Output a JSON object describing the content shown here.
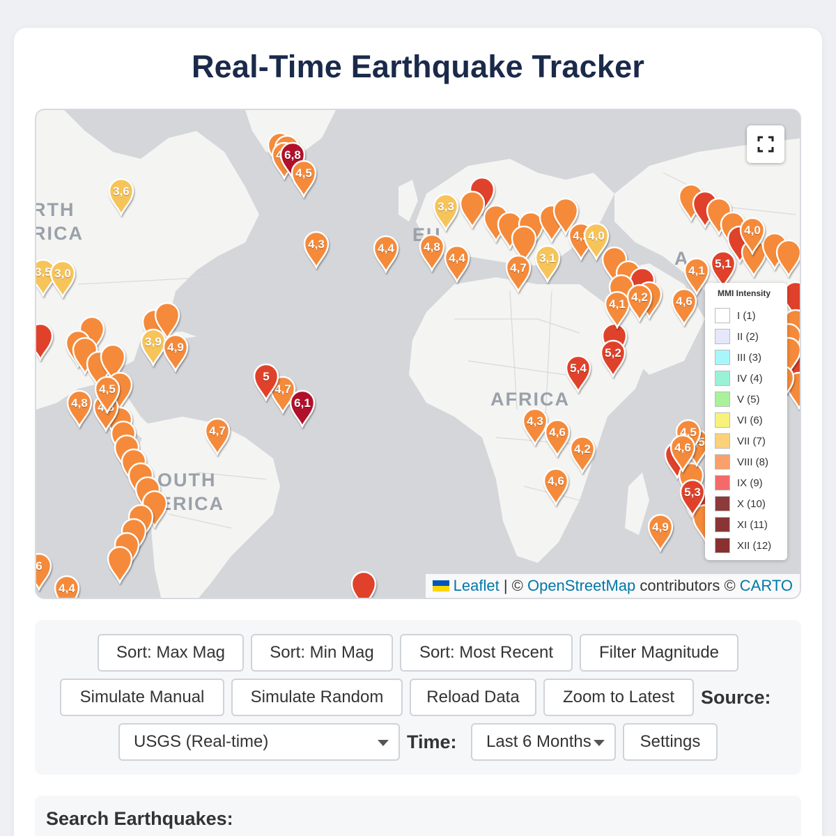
{
  "page": {
    "title": "Real-Time Earthquake Tracker"
  },
  "map": {
    "region_labels": [
      "RTH",
      "RICA",
      "EU",
      "AFRICA",
      "OUTH",
      "ERICA",
      "A"
    ],
    "fullscreen_icon": "fullscreen-icon",
    "legend": {
      "title": "MMI Intensity",
      "items": [
        {
          "label": "I (1)",
          "color": "#ffffff"
        },
        {
          "label": "II (2)",
          "color": "#e6e8fa"
        },
        {
          "label": "III (3)",
          "color": "#a7f6f9"
        },
        {
          "label": "IV (4)",
          "color": "#9af2d6"
        },
        {
          "label": "V (5)",
          "color": "#a9f29a"
        },
        {
          "label": "VI (6)",
          "color": "#f6f27a"
        },
        {
          "label": "VII (7)",
          "color": "#fbd27a"
        },
        {
          "label": "VIII (8)",
          "color": "#fba06a"
        },
        {
          "label": "IX (9)",
          "color": "#f46a6a"
        },
        {
          "label": "X (10)",
          "color": "#8c3a3a"
        },
        {
          "label": "XI (11)",
          "color": "#8a3535"
        },
        {
          "label": "XII (12)",
          "color": "#8a3030"
        }
      ]
    },
    "attribution": {
      "leaflet": "Leaflet",
      "sep1": " | © ",
      "osm": "OpenStreetMap",
      "mid": " contributors © ",
      "carto": "CARTO"
    },
    "colors": {
      "orange": "#f58a3a",
      "red": "#e0412a",
      "darkred": "#b0102a",
      "yellow": "#f7c45a"
    },
    "pins": [
      {
        "label": "3,6",
        "color": "yellow"
      },
      {
        "label": "4,6",
        "color": "orange"
      },
      {
        "label": "6,8",
        "color": "darkred"
      },
      {
        "label": "4,5",
        "color": "orange"
      },
      {
        "label": "3,3",
        "color": "yellow"
      },
      {
        "label": "4,3",
        "color": "orange"
      },
      {
        "label": "4,4",
        "color": "orange"
      },
      {
        "label": "4,8",
        "color": "orange"
      },
      {
        "label": "4,4",
        "color": "orange"
      },
      {
        "label": "4,7",
        "color": "orange"
      },
      {
        "label": "3,1",
        "color": "yellow"
      },
      {
        "label": "4,2",
        "color": "orange"
      },
      {
        "label": "4,8",
        "color": "orange"
      },
      {
        "label": "3,9",
        "color": "yellow"
      },
      {
        "label": "4,9",
        "color": "orange"
      },
      {
        "label": "4,8",
        "color": "orange"
      },
      {
        "label": "4,5",
        "color": "orange"
      },
      {
        "label": "4,7",
        "color": "orange"
      },
      {
        "label": "6,1",
        "color": "darkred"
      },
      {
        "label": "4,7",
        "color": "orange"
      },
      {
        "label": "4,5",
        "color": "orange"
      },
      {
        "label": "4,4",
        "color": "orange"
      },
      {
        "label": "5,4",
        "color": "red"
      },
      {
        "label": "5,2",
        "color": "red"
      },
      {
        "label": "4,3",
        "color": "orange"
      },
      {
        "label": "4,6",
        "color": "orange"
      },
      {
        "label": "4,2",
        "color": "orange"
      },
      {
        "label": "4,6",
        "color": "orange"
      },
      {
        "label": "4,1",
        "color": "orange"
      },
      {
        "label": "4,2",
        "color": "orange"
      },
      {
        "label": "4,6",
        "color": "orange"
      },
      {
        "label": "4,0",
        "color": "orange"
      },
      {
        "label": "4,1",
        "color": "orange"
      },
      {
        "label": "5,1",
        "color": "red"
      },
      {
        "label": "4,5",
        "color": "orange"
      },
      {
        "label": "4,9",
        "color": "orange"
      },
      {
        "label": "5,3",
        "color": "red"
      },
      {
        "label": "3,5",
        "color": "yellow"
      },
      {
        "label": "3,0",
        "color": "yellow"
      },
      {
        "label": "5",
        "color": "red"
      },
      {
        "label": "6",
        "color": "orange"
      },
      {
        "label": "4,6",
        "color": "orange"
      },
      {
        "label": "4,0",
        "color": "yellow"
      }
    ]
  },
  "controls": {
    "row1": [
      "Sort: Max Mag",
      "Sort: Min Mag",
      "Sort: Most Recent",
      "Filter Magnitude"
    ],
    "row2": [
      "Simulate Manual",
      "Simulate Random",
      "Reload Data",
      "Zoom to Latest"
    ],
    "source_label": "Source:",
    "source_value": "USGS (Real-time)",
    "time_label": "Time:",
    "time_value": "Last 6 Months",
    "settings": "Settings"
  },
  "search": {
    "label": "Search Earthquakes:"
  }
}
